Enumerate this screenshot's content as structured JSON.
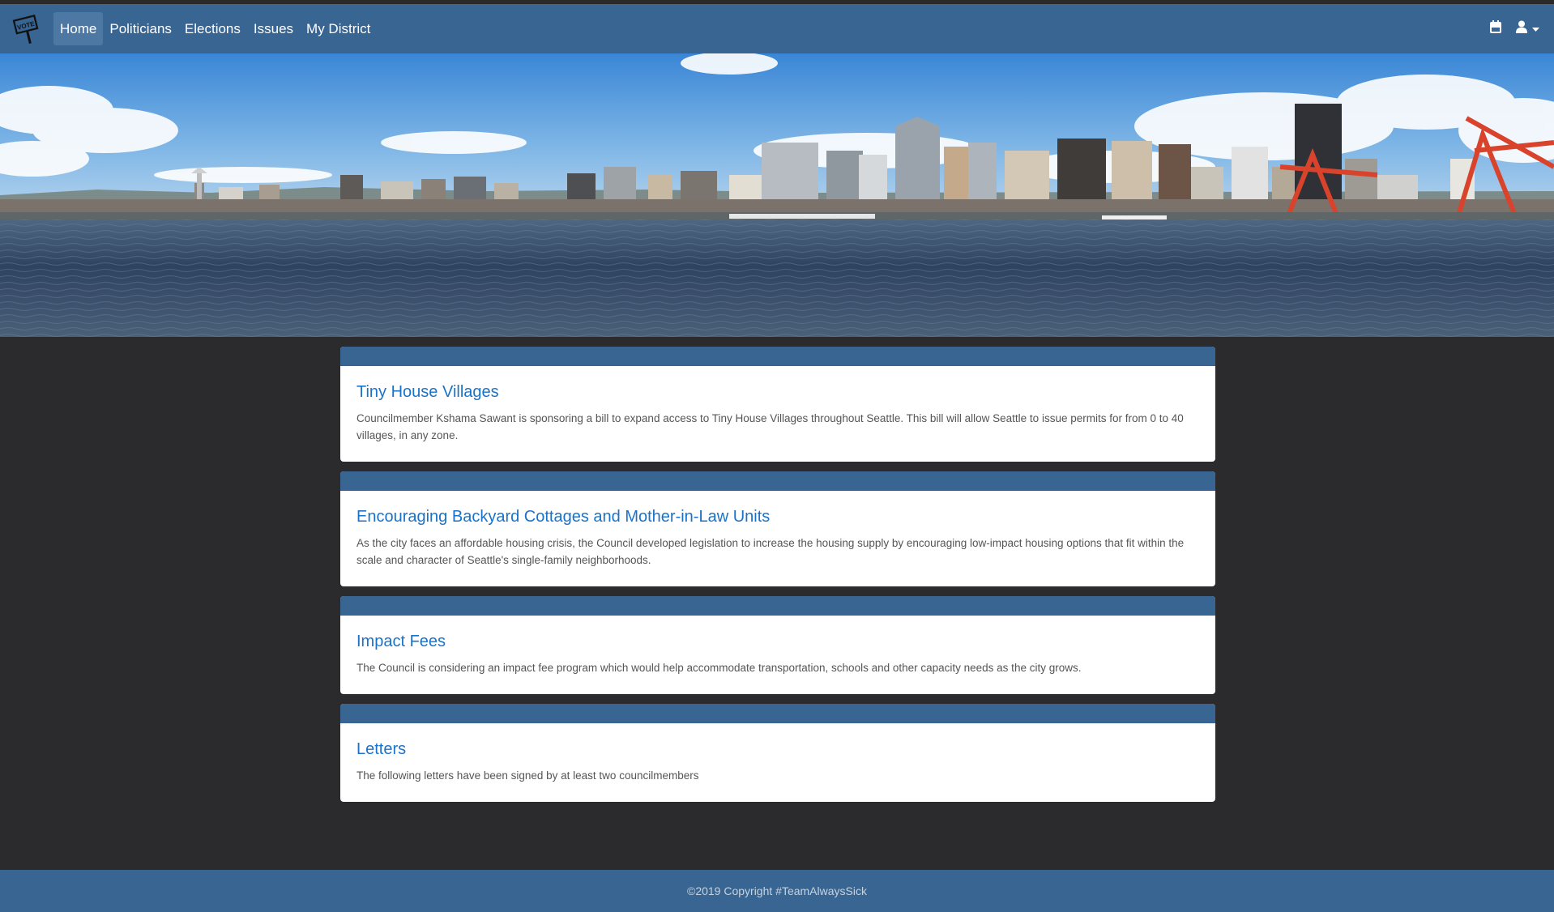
{
  "nav": {
    "logo": "vote-sign-logo",
    "items": [
      {
        "label": "Home",
        "active": true
      },
      {
        "label": "Politicians",
        "active": false
      },
      {
        "label": "Elections",
        "active": false
      },
      {
        "label": "Issues",
        "active": false
      },
      {
        "label": "My District",
        "active": false
      }
    ],
    "icons": [
      "calendar-icon",
      "user-icon",
      "caret-down-icon"
    ]
  },
  "hero": {
    "image": "seattle-skyline-waterfront-banner"
  },
  "cards": [
    {
      "title": "Tiny House Villages",
      "text": "Councilmember Kshama Sawant is sponsoring a bill to expand access to Tiny House Villages throughout Seattle. This bill will allow Seattle to issue permits for from 0 to 40 villages, in any zone."
    },
    {
      "title": "Encouraging Backyard Cottages and Mother-in-Law Units",
      "text": "As the city faces an affordable housing crisis, the Council developed legislation to increase the housing supply by encouraging low-impact housing options that fit within the scale and character of Seattle's single-family neighborhoods."
    },
    {
      "title": "Impact Fees",
      "text": "The Council is considering an impact fee program which would help accommodate transportation, schools and other capacity needs as the city grows."
    },
    {
      "title": "Letters",
      "text": "The following letters have been signed by at least two councilmembers"
    }
  ],
  "footer": {
    "copyright": "©2019 Copyright #TeamAlwaysSick"
  },
  "colors": {
    "navbar": "#386592",
    "background": "#2b2b2d",
    "link": "#1a73c9"
  }
}
